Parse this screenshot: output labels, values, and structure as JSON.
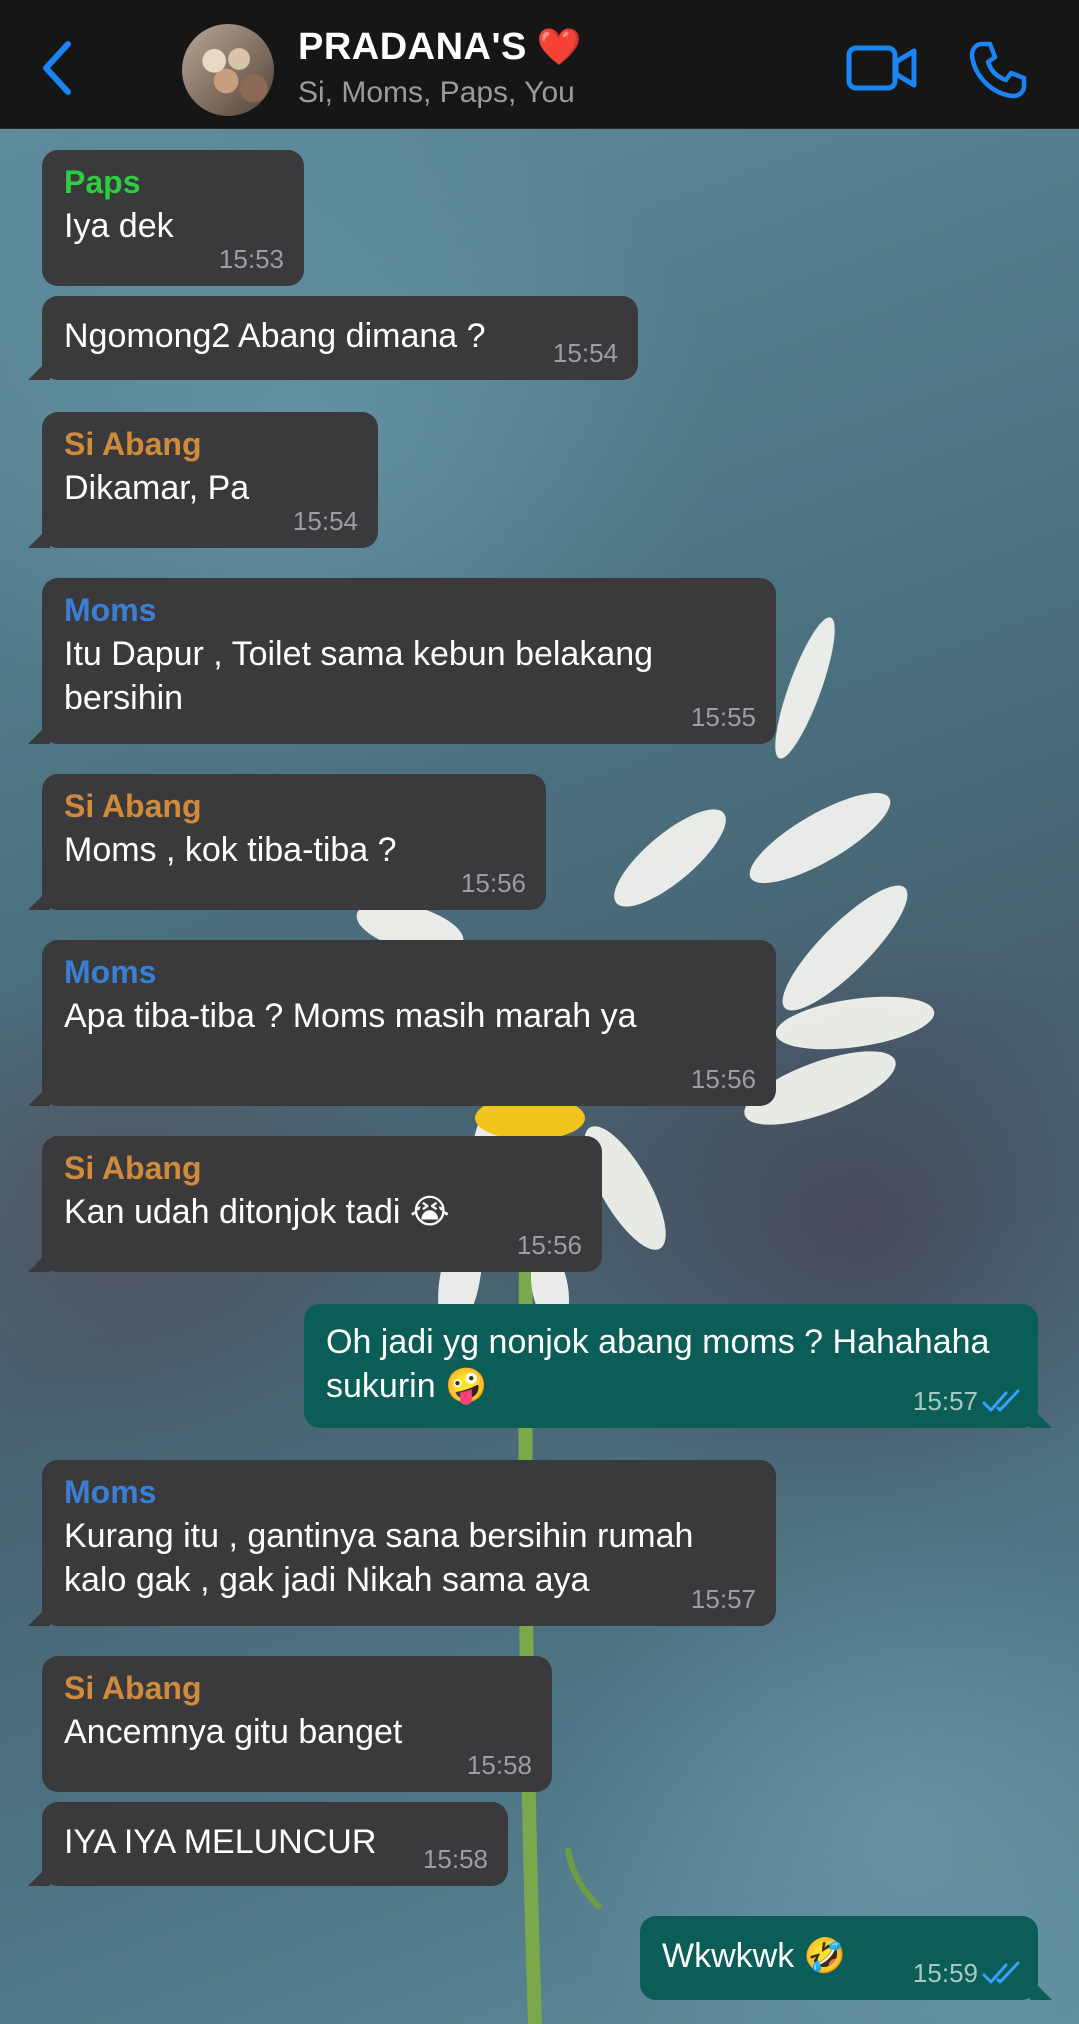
{
  "header": {
    "title": "PRADANA'S",
    "title_emoji": "❤️",
    "subtitle": "Si, Moms, Paps, You",
    "back_icon": "chevron-left-icon",
    "video_icon": "video-camera-icon",
    "call_icon": "phone-icon"
  },
  "colors": {
    "accent": "#1a86f5",
    "incoming_bubble": "#3a3a3c",
    "outgoing_bubble": "#0b5e58",
    "sender_paps": "#2ecc40",
    "sender_si_abang": "#d08a3c",
    "sender_moms": "#3b7fd4"
  },
  "messages": [
    {
      "sender": "Paps",
      "text": "Iya dek",
      "time": "15:53"
    },
    {
      "sender": "",
      "text": "Ngomong2 Abang dimana ?",
      "time": "15:54"
    },
    {
      "sender": "Si Abang",
      "text": "Dikamar, Pa",
      "time": "15:54"
    },
    {
      "sender": "Moms",
      "text": "Itu Dapur , Toilet sama kebun belakang bersihin",
      "time": "15:55"
    },
    {
      "sender": "Si Abang",
      "text": "Moms , kok tiba-tiba ?",
      "time": "15:56"
    },
    {
      "sender": "Moms",
      "text": "Apa tiba-tiba ? Moms masih marah ya",
      "time": "15:56"
    },
    {
      "sender": "Si Abang",
      "text": "Kan udah ditonjok tadi 😭",
      "time": "15:56"
    },
    {
      "sender": "You",
      "text": "Oh jadi yg nonjok abang moms ? Hahahaha sukurin 🤪",
      "time": "15:57"
    },
    {
      "sender": "Moms",
      "text": "Kurang itu , gantinya sana bersihin rumah kalo gak , gak jadi Nikah sama aya",
      "time": "15:57"
    },
    {
      "sender": "Si Abang",
      "text": "Ancemnya gitu banget",
      "time": "15:58"
    },
    {
      "sender": "",
      "text": "IYA IYA MELUNCUR",
      "time": "15:58"
    },
    {
      "sender": "You",
      "text": "Wkwkwk 🤣",
      "time": "15:59"
    }
  ]
}
